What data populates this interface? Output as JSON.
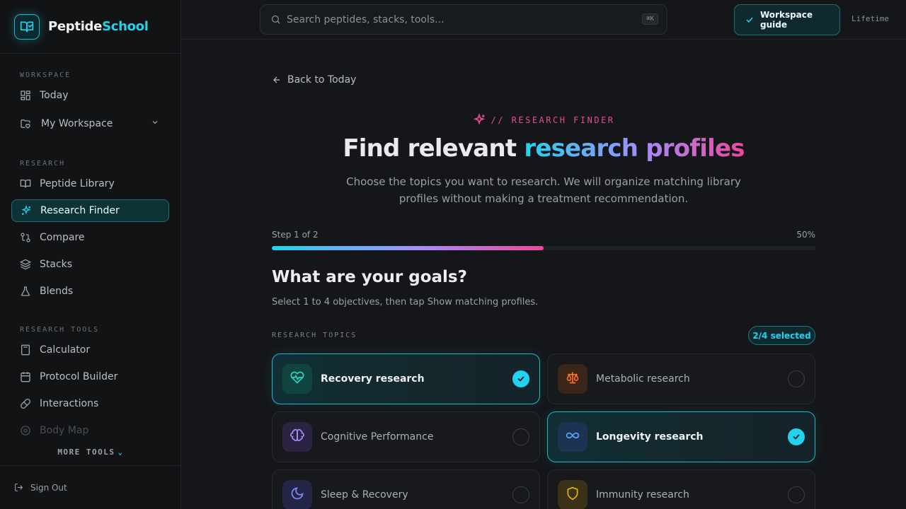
{
  "brand": {
    "name_part1": "Peptide",
    "name_part2": "School"
  },
  "sidebar": {
    "sections": [
      {
        "label": "WORKSPACE"
      },
      {
        "label": "RESEARCH"
      },
      {
        "label": "RESEARCH TOOLS"
      }
    ],
    "items": [
      {
        "label": "Today",
        "icon": "grid-icon"
      },
      {
        "label": "My Workspace",
        "icon": "folder-heart-icon"
      },
      {
        "label": "Peptide Library",
        "icon": "book-icon"
      },
      {
        "label": "Research Finder",
        "icon": "sparkles-icon",
        "active": true
      },
      {
        "label": "Compare",
        "icon": "compare-icon"
      },
      {
        "label": "Stacks",
        "icon": "layers-icon"
      },
      {
        "label": "Blends",
        "icon": "flask-icon"
      },
      {
        "label": "Calculator",
        "icon": "calculator-icon"
      },
      {
        "label": "Protocol Builder",
        "icon": "calendar-icon"
      },
      {
        "label": "Interactions",
        "icon": "pill-icon"
      },
      {
        "label": "Body Map",
        "icon": "target-icon"
      }
    ],
    "more_tools": "MORE TOOLS",
    "sign_out": "Sign Out"
  },
  "topbar": {
    "search_placeholder": "Search peptides, stacks, tools...",
    "search_shortcut": "⌘K",
    "guide_button": "Workspace guide",
    "plan_label": "Lifetime"
  },
  "main": {
    "back_link": "Back to Today",
    "eyebrow": "// RESEARCH FINDER",
    "headline_plain": "Find relevant ",
    "headline_gradient": "research profiles",
    "subtitle": "Choose the topics you want to research. We will organize matching library profiles without making a treatment recommendation.",
    "step_label": "Step 1 of 2",
    "progress_percent_label": "50%",
    "progress_fraction": 0.5,
    "goals_title": "What are your goals?",
    "goals_subtitle": "Select 1 to 4 objectives, then tap Show matching profiles.",
    "topics_label": "RESEARCH TOPICS",
    "selected_count": "2/4 selected",
    "topics": [
      {
        "label": "Recovery research",
        "icon": "heart-pulse-icon",
        "selected": true,
        "color": "#22d3ee"
      },
      {
        "label": "Metabolic research",
        "icon": "scale-icon",
        "selected": false,
        "color": "#f97316"
      },
      {
        "label": "Cognitive Performance",
        "icon": "brain-icon",
        "selected": false,
        "color": "#a78bfa"
      },
      {
        "label": "Longevity research",
        "icon": "infinity-icon",
        "selected": true,
        "color": "#60a5fa"
      },
      {
        "label": "Sleep & Recovery",
        "icon": "moon-icon",
        "selected": false,
        "color": "#818cf8"
      },
      {
        "label": "Immunity research",
        "icon": "shield-icon",
        "selected": false,
        "color": "#eab308"
      }
    ]
  },
  "colors": {
    "accent": "#22d3ee",
    "accent_pink": "#ec4899",
    "accent_violet": "#a78bfa",
    "bg": "#141619"
  }
}
